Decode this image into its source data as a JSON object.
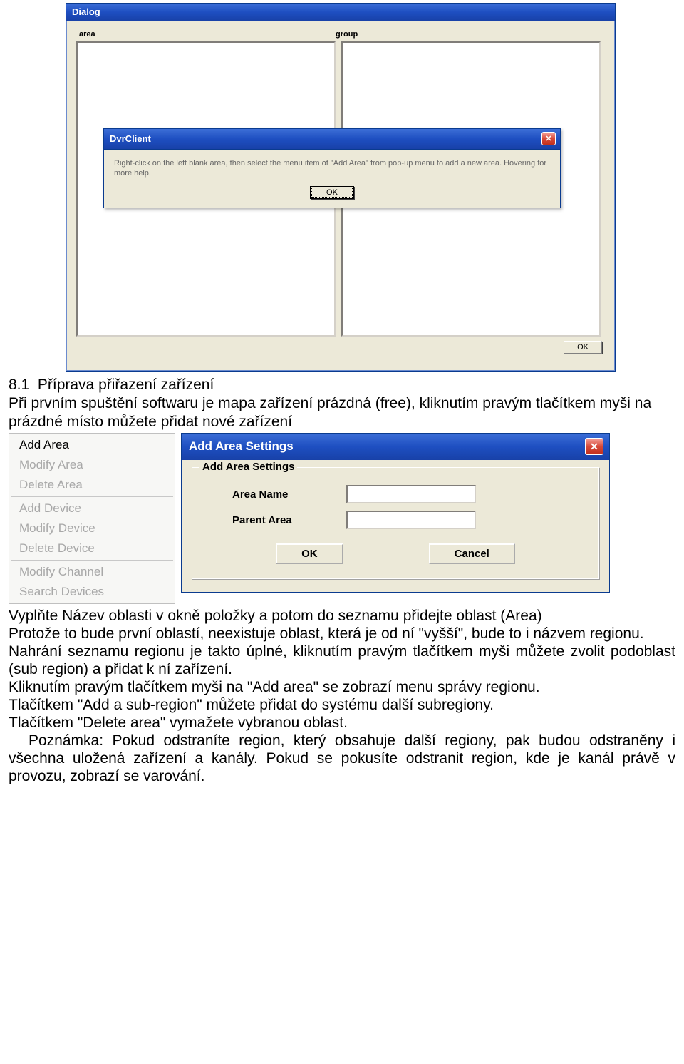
{
  "dialog": {
    "title": "Dialog",
    "label_area": "area",
    "label_group": "group",
    "ok": "OK"
  },
  "popup": {
    "title": "DvrClient",
    "message": "Right-click on the left blank area, then select the menu item of \"Add Area\" from pop-up menu to add a new area. Hovering for more help.",
    "ok": "OK"
  },
  "section": {
    "num": "8.1",
    "heading": "Příprava přiřazení zařízení",
    "p1": "Při prvním spuštění softwaru je mapa zařízení prázdná (free), kliknutím pravým tlačítkem myši na prázdné místo můžete přidat nové zařízení"
  },
  "ctxmenu": {
    "add_area": "Add Area",
    "modify_area": "Modify Area",
    "delete_area": "Delete Area",
    "add_device": "Add Device",
    "modify_device": "Modify Device",
    "delete_device": "Delete Device",
    "modify_channel": "Modify Channel",
    "search_devices": "Search Devices"
  },
  "aas": {
    "title": "Add Area Settings",
    "group_label": "Add Area Settings",
    "area_name": "Area Name",
    "parent_area": "Parent Area",
    "ok": "OK",
    "cancel": "Cancel"
  },
  "body": {
    "p2": "Vyplňte Název oblasti v okně položky a potom do seznamu přidejte oblast (Area)",
    "p3": "Protože to bude první oblastí, neexistuje oblast, která je od ní \"vyšší\", bude to i názvem regionu.",
    "p4": "Nahrání seznamu regionu je takto úplné, kliknutím pravým tlačítkem myši můžete zvolit podoblast (sub region) a přidat k ní zařízení.",
    "p5": "Kliknutím pravým tlačítkem myši na \"Add area\" se zobrazí menu správy regionu.",
    "p6": "Tlačítkem \"Add a sub-region\" můžete přidat do systému další subregiony.",
    "p7": "Tlačítkem \"Delete area\" vymažete vybranou oblast.",
    "p8": "Poznámka: Pokud odstraníte region, který obsahuje další regiony, pak budou odstraněny i všechna uložená zařízení a kanály. Pokud se pokusíte odstranit region, kde je kanál právě v provozu, zobrazí se varování."
  }
}
